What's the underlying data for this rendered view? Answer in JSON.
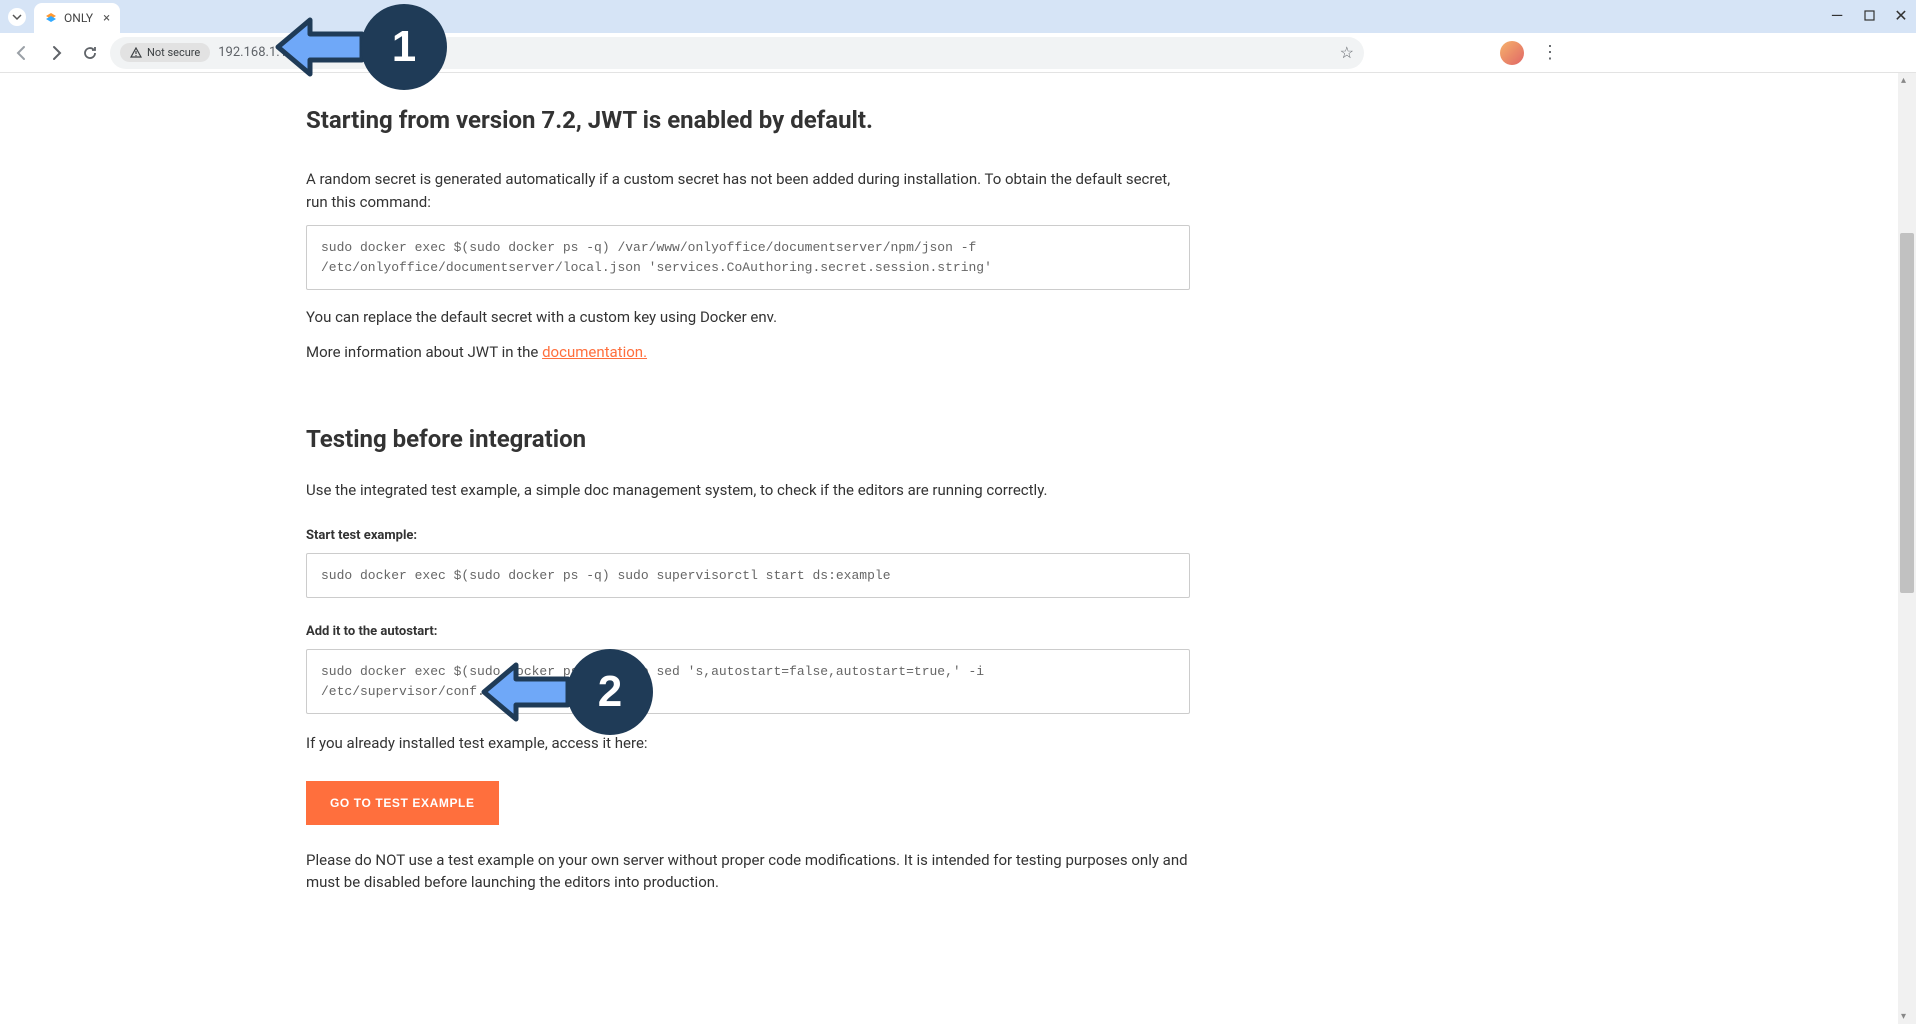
{
  "browser": {
    "tab_title": "ONLY",
    "not_secure_label": "Not secure",
    "url": "192.168.1.18:8467"
  },
  "page": {
    "jwt_heading": "Starting from version 7.2, JWT is enabled by default.",
    "jwt_intro": "A random secret is generated automatically if a custom secret has not been added during installation. To obtain the default secret, run this command:",
    "jwt_command": "sudo docker exec $(sudo docker ps -q) /var/www/onlyoffice/documentserver/npm/json -f /etc/onlyoffice/documentserver/local.json 'services.CoAuthoring.secret.session.string'",
    "jwt_replace": "You can replace the default secret with a custom key using Docker env.",
    "jwt_more_pre": "More information about JWT in the ",
    "jwt_doc_link": "documentation.",
    "testing_heading": "Testing before integration",
    "testing_intro": "Use the integrated test example, a simple doc management system, to check if the editors are running correctly.",
    "start_label": "Start test example:",
    "start_command": "sudo docker exec $(sudo docker ps -q) sudo supervisorctl start ds:example",
    "autostart_label": "Add it to the autostart:",
    "autostart_command": "sudo docker exec $(sudo docker ps -q) sudo sed 's,autostart=false,autostart=true,' -i /etc/supervisor/conf.d/ds-example.conf",
    "access_text": "If you already installed test example, access it here:",
    "go_button": "GO TO TEST EXAMPLE",
    "warning": "Please do NOT use a test example on your own server without proper code modifications. It is intended for testing purposes only and must be disabled before launching the editors into production."
  },
  "annotations": {
    "one": "1",
    "two": "2"
  }
}
